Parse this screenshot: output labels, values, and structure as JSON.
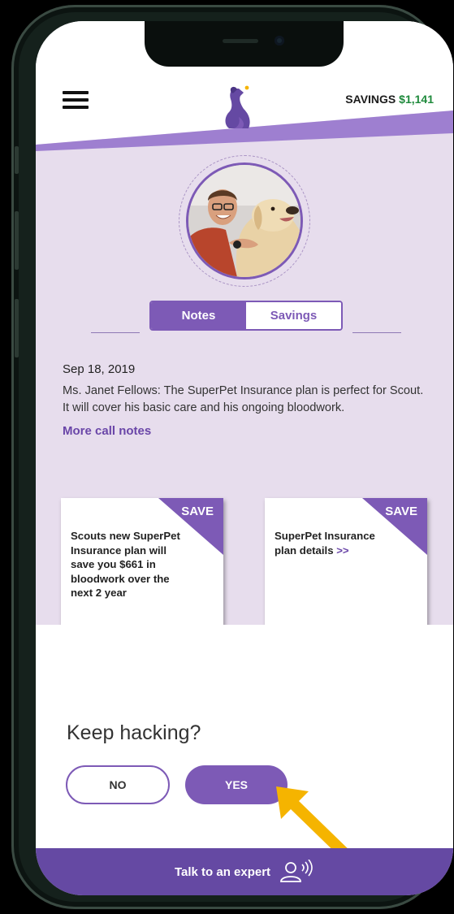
{
  "header": {
    "savings_label": "SAVINGS",
    "savings_amount": "$1,141"
  },
  "tabs": [
    {
      "label": "Notes",
      "active": true
    },
    {
      "label": "Savings",
      "active": false
    }
  ],
  "note": {
    "date": "Sep 18, 2019",
    "body": "Ms. Janet Fellows: The SuperPet Insurance plan is perfect for Scout.  It will cover his basic care and his ongoing bloodwork.",
    "more_link": "More call notes"
  },
  "cards": [
    {
      "badge": "SAVE",
      "text": "Scouts new SuperPet Insurance plan will save you $661 in bloodwork over the next 2 year",
      "link": ""
    },
    {
      "badge": "SAVE",
      "text": "SuperPet Insurance plan details",
      "link": ">>"
    }
  ],
  "prompt": {
    "question": "Keep hacking?",
    "no_label": "NO",
    "yes_label": "YES"
  },
  "footer": {
    "label": "Talk to an expert",
    "icon": "agent-speaking-icon"
  },
  "colors": {
    "primary": "#7d5ab6",
    "footer": "#6549a3",
    "background": "#e7dded",
    "savings_green": "#1f8a3c",
    "arrow": "#f5b400"
  }
}
